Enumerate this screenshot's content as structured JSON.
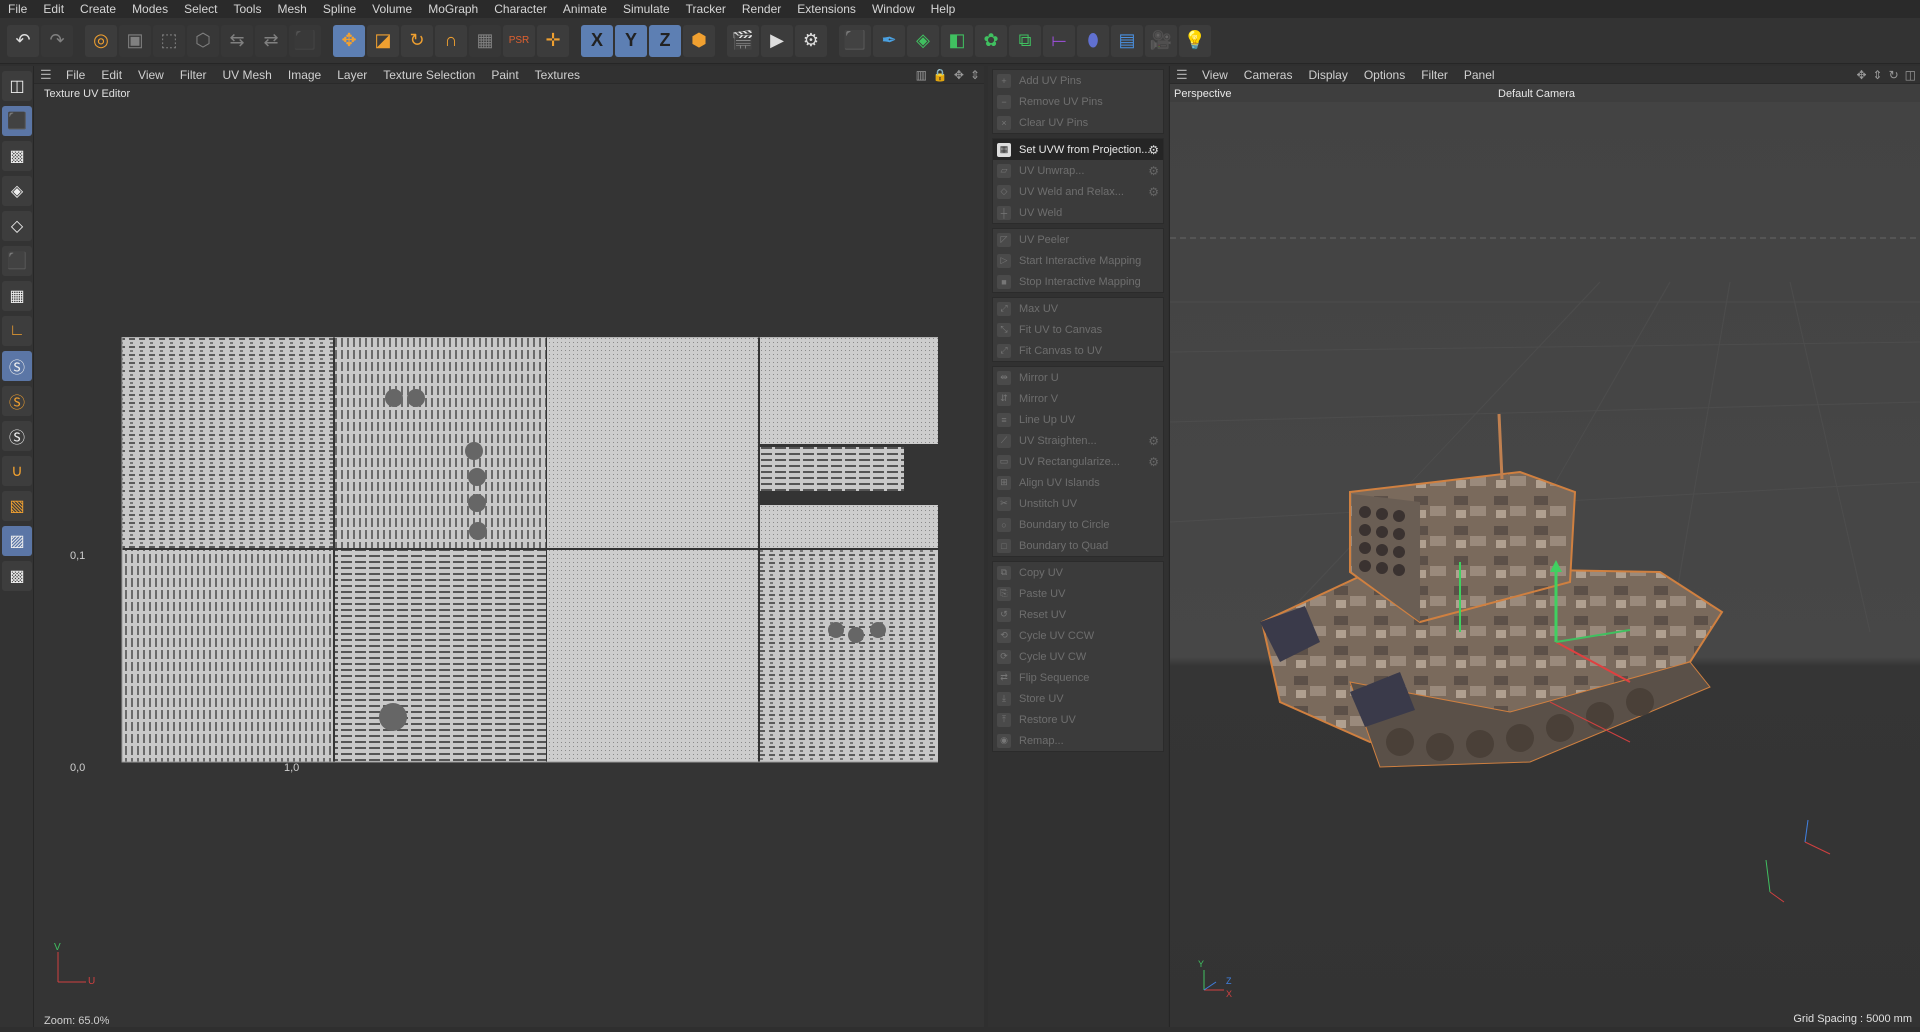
{
  "menubar": {
    "items": [
      "File",
      "Edit",
      "Create",
      "Modes",
      "Select",
      "Tools",
      "Mesh",
      "Spline",
      "Volume",
      "MoGraph",
      "Character",
      "Animate",
      "Simulate",
      "Tracker",
      "Render",
      "Extensions",
      "Window",
      "Help"
    ]
  },
  "uv_editor": {
    "menu": [
      "File",
      "Edit",
      "View",
      "Filter",
      "UV Mesh",
      "Image",
      "Layer",
      "Texture Selection",
      "Paint",
      "Textures"
    ],
    "title": "Texture UV Editor",
    "label_01": "0,1",
    "label_00": "0,0",
    "label_10": "1,0",
    "zoom": "Zoom: 65.0%",
    "axis_v": "V",
    "axis_u": "U"
  },
  "commands": {
    "groups": [
      [
        "Add UV Pins",
        "Remove UV Pins",
        "Clear UV Pins"
      ],
      [
        "Set UVW from Projection...",
        "UV Unwrap...",
        "UV Weld and Relax...",
        "UV Weld"
      ],
      [
        "UV Peeler",
        "Start Interactive Mapping",
        "Stop Interactive Mapping"
      ],
      [
        "Max UV",
        "Fit UV to Canvas",
        "Fit Canvas to UV"
      ],
      [
        "Mirror U",
        "Mirror V",
        "Line Up UV",
        "UV Straighten...",
        "UV Rectangularize...",
        "Align UV Islands",
        "Unstitch UV",
        "Boundary to Circle",
        "Boundary to Quad"
      ],
      [
        "Copy UV",
        "Paste UV",
        "Reset UV",
        "Cycle UV CCW",
        "Cycle UV CW",
        "Flip Sequence",
        "Store UV",
        "Restore UV",
        "Remap..."
      ]
    ]
  },
  "viewport": {
    "menu": [
      "View",
      "Cameras",
      "Display",
      "Options",
      "Filter",
      "Panel"
    ],
    "title": "Perspective",
    "camera": "Default Camera",
    "grid_spacing": "Grid Spacing : 5000 mm"
  }
}
